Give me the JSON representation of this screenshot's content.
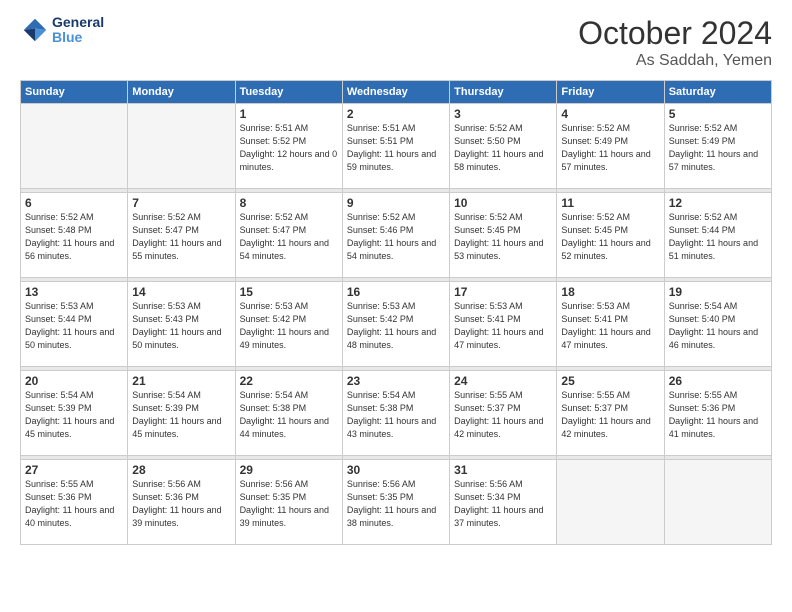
{
  "header": {
    "logo_line1": "General",
    "logo_line2": "Blue",
    "month": "October 2024",
    "location": "As Saddah, Yemen"
  },
  "days_of_week": [
    "Sunday",
    "Monday",
    "Tuesday",
    "Wednesday",
    "Thursday",
    "Friday",
    "Saturday"
  ],
  "weeks": [
    [
      {
        "day": "",
        "info": ""
      },
      {
        "day": "",
        "info": ""
      },
      {
        "day": "1",
        "sunrise": "Sunrise: 5:51 AM",
        "sunset": "Sunset: 5:52 PM",
        "daylight": "Daylight: 12 hours and 0 minutes."
      },
      {
        "day": "2",
        "sunrise": "Sunrise: 5:51 AM",
        "sunset": "Sunset: 5:51 PM",
        "daylight": "Daylight: 11 hours and 59 minutes."
      },
      {
        "day": "3",
        "sunrise": "Sunrise: 5:52 AM",
        "sunset": "Sunset: 5:50 PM",
        "daylight": "Daylight: 11 hours and 58 minutes."
      },
      {
        "day": "4",
        "sunrise": "Sunrise: 5:52 AM",
        "sunset": "Sunset: 5:49 PM",
        "daylight": "Daylight: 11 hours and 57 minutes."
      },
      {
        "day": "5",
        "sunrise": "Sunrise: 5:52 AM",
        "sunset": "Sunset: 5:49 PM",
        "daylight": "Daylight: 11 hours and 57 minutes."
      }
    ],
    [
      {
        "day": "6",
        "sunrise": "Sunrise: 5:52 AM",
        "sunset": "Sunset: 5:48 PM",
        "daylight": "Daylight: 11 hours and 56 minutes."
      },
      {
        "day": "7",
        "sunrise": "Sunrise: 5:52 AM",
        "sunset": "Sunset: 5:47 PM",
        "daylight": "Daylight: 11 hours and 55 minutes."
      },
      {
        "day": "8",
        "sunrise": "Sunrise: 5:52 AM",
        "sunset": "Sunset: 5:47 PM",
        "daylight": "Daylight: 11 hours and 54 minutes."
      },
      {
        "day": "9",
        "sunrise": "Sunrise: 5:52 AM",
        "sunset": "Sunset: 5:46 PM",
        "daylight": "Daylight: 11 hours and 54 minutes."
      },
      {
        "day": "10",
        "sunrise": "Sunrise: 5:52 AM",
        "sunset": "Sunset: 5:45 PM",
        "daylight": "Daylight: 11 hours and 53 minutes."
      },
      {
        "day": "11",
        "sunrise": "Sunrise: 5:52 AM",
        "sunset": "Sunset: 5:45 PM",
        "daylight": "Daylight: 11 hours and 52 minutes."
      },
      {
        "day": "12",
        "sunrise": "Sunrise: 5:52 AM",
        "sunset": "Sunset: 5:44 PM",
        "daylight": "Daylight: 11 hours and 51 minutes."
      }
    ],
    [
      {
        "day": "13",
        "sunrise": "Sunrise: 5:53 AM",
        "sunset": "Sunset: 5:44 PM",
        "daylight": "Daylight: 11 hours and 50 minutes."
      },
      {
        "day": "14",
        "sunrise": "Sunrise: 5:53 AM",
        "sunset": "Sunset: 5:43 PM",
        "daylight": "Daylight: 11 hours and 50 minutes."
      },
      {
        "day": "15",
        "sunrise": "Sunrise: 5:53 AM",
        "sunset": "Sunset: 5:42 PM",
        "daylight": "Daylight: 11 hours and 49 minutes."
      },
      {
        "day": "16",
        "sunrise": "Sunrise: 5:53 AM",
        "sunset": "Sunset: 5:42 PM",
        "daylight": "Daylight: 11 hours and 48 minutes."
      },
      {
        "day": "17",
        "sunrise": "Sunrise: 5:53 AM",
        "sunset": "Sunset: 5:41 PM",
        "daylight": "Daylight: 11 hours and 47 minutes."
      },
      {
        "day": "18",
        "sunrise": "Sunrise: 5:53 AM",
        "sunset": "Sunset: 5:41 PM",
        "daylight": "Daylight: 11 hours and 47 minutes."
      },
      {
        "day": "19",
        "sunrise": "Sunrise: 5:54 AM",
        "sunset": "Sunset: 5:40 PM",
        "daylight": "Daylight: 11 hours and 46 minutes."
      }
    ],
    [
      {
        "day": "20",
        "sunrise": "Sunrise: 5:54 AM",
        "sunset": "Sunset: 5:39 PM",
        "daylight": "Daylight: 11 hours and 45 minutes."
      },
      {
        "day": "21",
        "sunrise": "Sunrise: 5:54 AM",
        "sunset": "Sunset: 5:39 PM",
        "daylight": "Daylight: 11 hours and 45 minutes."
      },
      {
        "day": "22",
        "sunrise": "Sunrise: 5:54 AM",
        "sunset": "Sunset: 5:38 PM",
        "daylight": "Daylight: 11 hours and 44 minutes."
      },
      {
        "day": "23",
        "sunrise": "Sunrise: 5:54 AM",
        "sunset": "Sunset: 5:38 PM",
        "daylight": "Daylight: 11 hours and 43 minutes."
      },
      {
        "day": "24",
        "sunrise": "Sunrise: 5:55 AM",
        "sunset": "Sunset: 5:37 PM",
        "daylight": "Daylight: 11 hours and 42 minutes."
      },
      {
        "day": "25",
        "sunrise": "Sunrise: 5:55 AM",
        "sunset": "Sunset: 5:37 PM",
        "daylight": "Daylight: 11 hours and 42 minutes."
      },
      {
        "day": "26",
        "sunrise": "Sunrise: 5:55 AM",
        "sunset": "Sunset: 5:36 PM",
        "daylight": "Daylight: 11 hours and 41 minutes."
      }
    ],
    [
      {
        "day": "27",
        "sunrise": "Sunrise: 5:55 AM",
        "sunset": "Sunset: 5:36 PM",
        "daylight": "Daylight: 11 hours and 40 minutes."
      },
      {
        "day": "28",
        "sunrise": "Sunrise: 5:56 AM",
        "sunset": "Sunset: 5:36 PM",
        "daylight": "Daylight: 11 hours and 39 minutes."
      },
      {
        "day": "29",
        "sunrise": "Sunrise: 5:56 AM",
        "sunset": "Sunset: 5:35 PM",
        "daylight": "Daylight: 11 hours and 39 minutes."
      },
      {
        "day": "30",
        "sunrise": "Sunrise: 5:56 AM",
        "sunset": "Sunset: 5:35 PM",
        "daylight": "Daylight: 11 hours and 38 minutes."
      },
      {
        "day": "31",
        "sunrise": "Sunrise: 5:56 AM",
        "sunset": "Sunset: 5:34 PM",
        "daylight": "Daylight: 11 hours and 37 minutes."
      },
      {
        "day": "",
        "info": ""
      },
      {
        "day": "",
        "info": ""
      }
    ]
  ]
}
